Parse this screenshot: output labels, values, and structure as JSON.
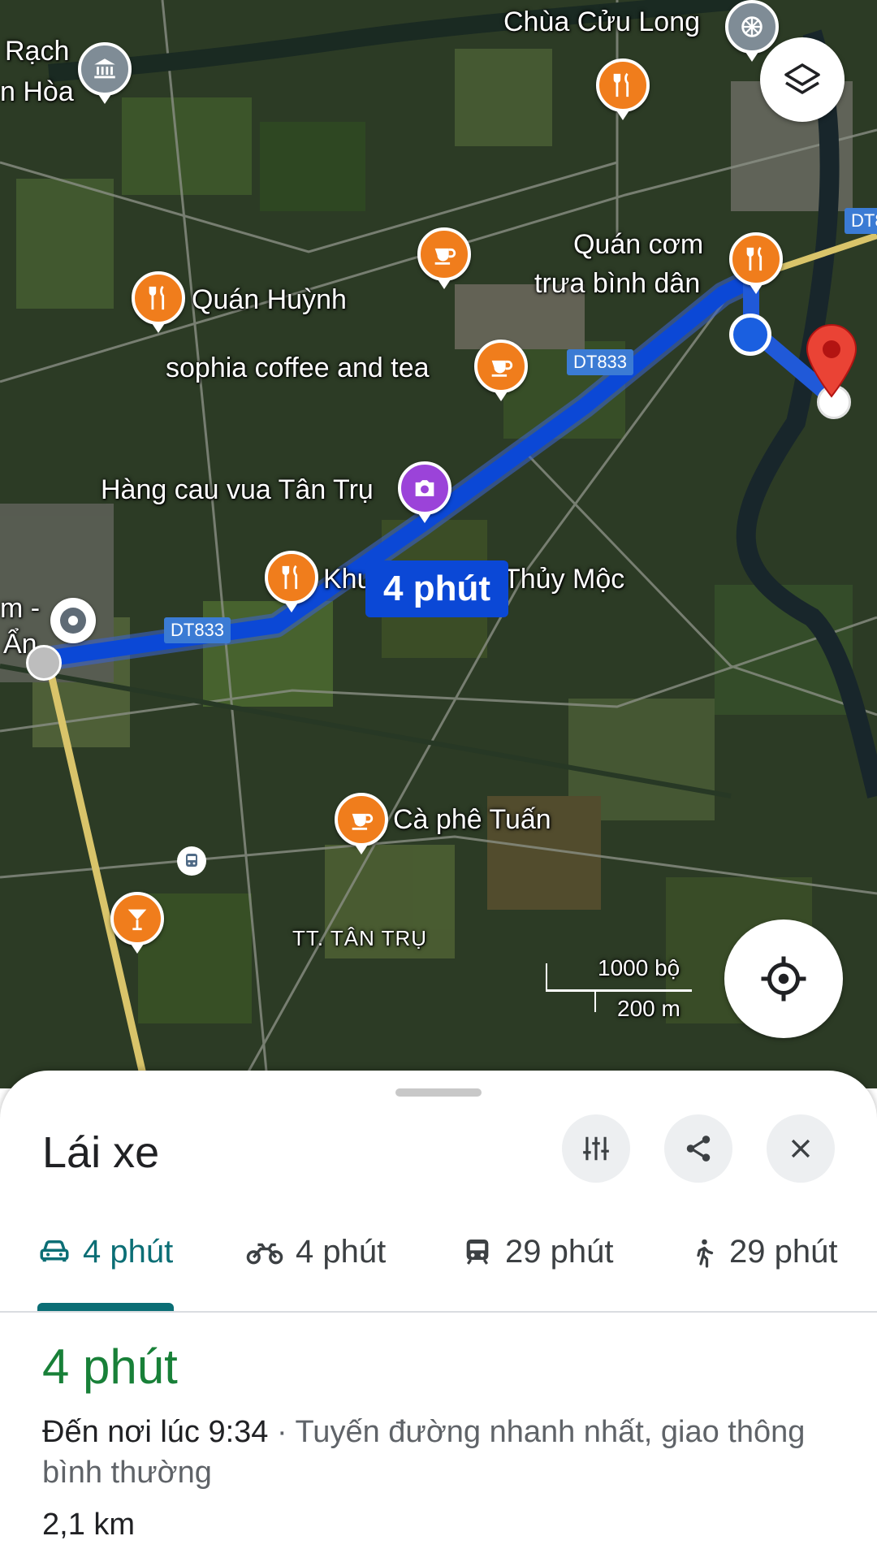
{
  "map": {
    "labels": {
      "chua": "Chùa Cửu Long",
      "rach": "Rạch",
      "hoa": "n Hòa",
      "quan_com_1": "Quán cơm",
      "quan_com_2": "trưa bình dân",
      "quan_huynh": "Quán Huỳnh",
      "sophia": "sophia coffee and tea",
      "hang_cau": "Hàng cau vua Tân Trụ",
      "khu": "Khu",
      "thuy_moc": "Thủy Mộc",
      "m_dash": "m -",
      "an": "Ẩn",
      "ca_phe": "Cà phê Tuấn",
      "tt_tan_tru": "TT. TÂN TRỤ",
      "dt8": "DT8",
      "road_1": "DT833",
      "road_2": "DT833"
    },
    "route_time": "4 phút",
    "scale": {
      "feet": "1000 bộ",
      "meters": "200 m"
    },
    "route_color": "#0b48d6"
  },
  "sheet": {
    "title": "Lái xe",
    "tabs": [
      {
        "icon": "car-icon",
        "label": "4 phút"
      },
      {
        "icon": "motorbike-icon",
        "label": "4 phút"
      },
      {
        "icon": "transit-icon",
        "label": "29 phút"
      },
      {
        "icon": "walk-icon",
        "label": "29 phút"
      }
    ],
    "duration": "4 phút",
    "arrive": "Đến nơi lúc 9:34",
    "route_desc": " · Tuyến đường nhanh nhất, giao thông bình thường",
    "distance": "2,1 km"
  },
  "colors": {
    "accent": "#0b6e75",
    "duration_green": "#188038",
    "poi_orange": "#f07d1c"
  }
}
